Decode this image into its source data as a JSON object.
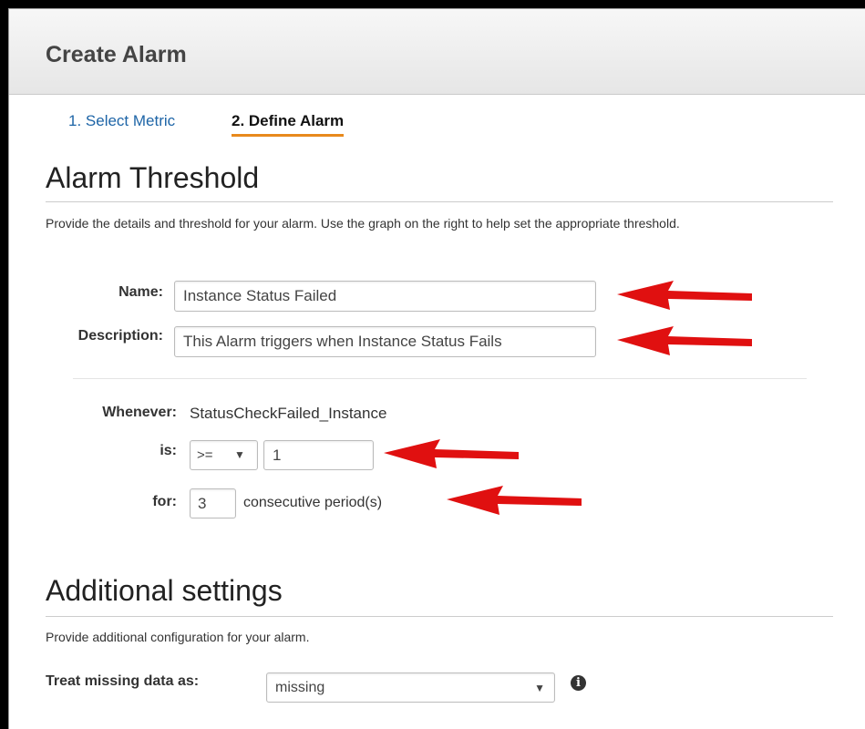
{
  "header": {
    "title": "Create Alarm"
  },
  "steps": [
    {
      "label": "1. Select Metric",
      "active": false
    },
    {
      "label": "2. Define Alarm",
      "active": true
    }
  ],
  "alarm_threshold": {
    "title": "Alarm Threshold",
    "description": "Provide the details and threshold for your alarm. Use the graph on the right to help set the appropriate threshold.",
    "name_label": "Name:",
    "name_value": "Instance Status Failed",
    "description_label": "Description:",
    "description_value": "This Alarm triggers when Instance Status Fails",
    "whenever_label": "Whenever:",
    "metric_name": "StatusCheckFailed_Instance",
    "is_label": "is:",
    "operator": ">=",
    "threshold_value": "1",
    "for_label": "for:",
    "periods_value": "3",
    "periods_suffix": "consecutive period(s)"
  },
  "additional_settings": {
    "title": "Additional settings",
    "description": "Provide additional configuration for your alarm.",
    "missing_data_label": "Treat missing data as:",
    "missing_data_value": "missing"
  },
  "icons": {
    "dropdown": "chevron-down-icon",
    "info": "info-icon",
    "annotation_arrow": "red-arrow-left-icon"
  },
  "colors": {
    "step_link": "#1e65a7",
    "active_step_underline": "#e8891c",
    "annotation_arrow": "#e01010"
  }
}
